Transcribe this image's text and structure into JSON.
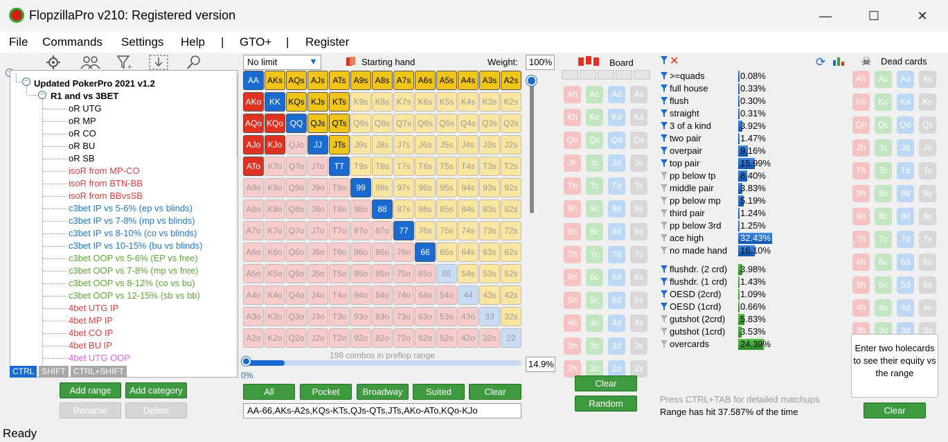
{
  "window": {
    "title": "FlopzillaPro v210: Registered version",
    "minimize": "—",
    "maximize": "☐",
    "close": "✕"
  },
  "menu": [
    "File",
    "Commands",
    "Settings",
    "Help",
    "|",
    "GTO+",
    "|",
    "Register"
  ],
  "toolbar_icons": [
    "settings-icon",
    "players-icon",
    "filter-icon",
    "import-icon",
    "search-icon"
  ],
  "tree": {
    "root": "Updated PokerPro 2021 v1.2",
    "group": "R1 and vs 3BET",
    "items": [
      {
        "label": "oR UTG",
        "color": "#000000"
      },
      {
        "label": "oR MP",
        "color": "#000000"
      },
      {
        "label": "oR CO",
        "color": "#000000"
      },
      {
        "label": "oR BU",
        "color": "#000000"
      },
      {
        "label": "oR SB",
        "color": "#000000"
      },
      {
        "label": "isoR from MP-CO",
        "color": "#e03c3c"
      },
      {
        "label": "isoR from BTN-BB",
        "color": "#e03c3c"
      },
      {
        "label": "isoR from BBvsSB",
        "color": "#e03c3c"
      },
      {
        "label": "c3bet IP vs 5-6% (ep vs blinds)",
        "color": "#1f77c8"
      },
      {
        "label": "c3bet IP vs 7-8% (mp vs blinds)",
        "color": "#1f77c8"
      },
      {
        "label": "c3bet IP vs 8-10% (co vs blinds)",
        "color": "#1f77c8"
      },
      {
        "label": "c3bet IP vs 10-15% (bu vs blinds)",
        "color": "#1f77c8"
      },
      {
        "label": "c3bet OOP vs 5-6% (EP vs free)",
        "color": "#5aa832"
      },
      {
        "label": "c3bet OOP vs 7-8% (mp vs free)",
        "color": "#5aa832"
      },
      {
        "label": "c3bet OOP vs 8-12% (co vs bu)",
        "color": "#5aa832"
      },
      {
        "label": "c3bet OOP vs 12-15% (sb vs bb)",
        "color": "#5aa832"
      },
      {
        "label": "4bet UTG IP",
        "color": "#e03c3c"
      },
      {
        "label": "4bet MP IP",
        "color": "#e03c3c"
      },
      {
        "label": "4bet CO IP",
        "color": "#e03c3c"
      },
      {
        "label": "4bet BU IP",
        "color": "#e03c3c"
      },
      {
        "label": "4bet UTG OOP",
        "color": "#e060e0"
      }
    ]
  },
  "modifiers": [
    "CTRL",
    "SHIFT",
    "CTRL+SHIFT"
  ],
  "range_buttons": {
    "add_range": "Add range",
    "add_category": "Add category",
    "rename": "Rename",
    "delete": "Delete"
  },
  "range": {
    "game_type": "No limit",
    "starting_hand_label": "Starting hand",
    "weight_label": "Weight:",
    "weight": "100%",
    "combos_text": "198 combos in preflop range",
    "percent": "14.9%",
    "progress_label": "0%",
    "progress": 0.149,
    "text": "AA-66,AKs-A2s,KQs-KTs,QJs-QTs,JTs,AKo-ATo,KQo-KJo"
  },
  "ranks": [
    "A",
    "K",
    "Q",
    "J",
    "T",
    "9",
    "8",
    "7",
    "6",
    "5",
    "4",
    "3",
    "2"
  ],
  "selected_hands": [
    "AA",
    "KK",
    "QQ",
    "JJ",
    "TT",
    "99",
    "88",
    "77",
    "66",
    "AKs",
    "AQs",
    "AJs",
    "ATs",
    "A9s",
    "A8s",
    "A7s",
    "A6s",
    "A5s",
    "A4s",
    "A3s",
    "A2s",
    "KQs",
    "KJs",
    "KTs",
    "QJs",
    "QTs",
    "JTs",
    "AKo",
    "AQo",
    "AJo",
    "ATo",
    "KQo",
    "KJo"
  ],
  "quick_buttons": [
    "All",
    "Pocket",
    "Broadway",
    "Suited",
    "Clear"
  ],
  "board": {
    "title": "Board",
    "clear": "Clear",
    "random": "Random",
    "suits": [
      "h",
      "c",
      "d",
      "s"
    ]
  },
  "dead": {
    "title": "Dead cards",
    "help": "Enter two holecards to see their equity vs the range",
    "clear": "Clear"
  },
  "colors": {
    "suit_h": "#f6c2c2",
    "suit_c": "#c2e6c0",
    "suit_d": "#bcd8f6",
    "suit_s": "#d8d8d8",
    "pair": "#c8dcf6",
    "suited": "#fbe6a0",
    "offsuit": "#f9cccc",
    "sel_pair": "#1a6bd1",
    "sel_suited": "#f0c419",
    "sel_offsuit": "#e03220"
  },
  "stats": [
    {
      "label": "&gt;=quads",
      "pct": "0.08%",
      "value": 0.08,
      "active": true,
      "type": "made"
    },
    {
      "label": "full house",
      "pct": "0.33%",
      "value": 0.33,
      "active": true,
      "type": "made"
    },
    {
      "label": "flush",
      "pct": "0.30%",
      "value": 0.3,
      "active": true,
      "type": "made"
    },
    {
      "label": "straight",
      "pct": "0.31%",
      "value": 0.31,
      "active": true,
      "type": "made"
    },
    {
      "label": "3 of a kind",
      "pct": "3.92%",
      "value": 3.92,
      "active": true,
      "type": "made"
    },
    {
      "label": "two pair",
      "pct": "1.47%",
      "value": 1.47,
      "active": true,
      "type": "made"
    },
    {
      "label": "overpair",
      "pct": "9.16%",
      "value": 9.16,
      "active": true,
      "type": "made"
    },
    {
      "label": "top pair",
      "pct": "15.99%",
      "value": 15.99,
      "active": true,
      "type": "made"
    },
    {
      "label": "pp below tp",
      "pct": "8.40%",
      "value": 8.4,
      "active": false,
      "type": "made"
    },
    {
      "label": "middle pair",
      "pct": "3.83%",
      "value": 3.83,
      "active": false,
      "type": "made"
    },
    {
      "label": "pp below mp",
      "pct": "5.19%",
      "value": 5.19,
      "active": false,
      "type": "made"
    },
    {
      "label": "third pair",
      "pct": "1.24%",
      "value": 1.24,
      "active": false,
      "type": "made"
    },
    {
      "label": "pp below 3rd",
      "pct": "1.25%",
      "value": 1.25,
      "active": false,
      "type": "made"
    },
    {
      "label": "ace high",
      "pct": "32.43%",
      "value": 32.43,
      "active": false,
      "type": "made"
    },
    {
      "label": "no made hand",
      "pct": "16.10%",
      "value": 16.1,
      "active": false,
      "type": "made"
    },
    {
      "label": "flushdr. (2 crd)",
      "pct": "3.98%",
      "value": 3.98,
      "active": true,
      "type": "draw"
    },
    {
      "label": "flushdr. (1 crd)",
      "pct": "1.43%",
      "value": 1.43,
      "active": true,
      "type": "draw"
    },
    {
      "label": "OESD (2crd)",
      "pct": "1.09%",
      "value": 1.09,
      "active": true,
      "type": "draw"
    },
    {
      "label": "OESD (1crd)",
      "pct": "0.66%",
      "value": 0.66,
      "active": true,
      "type": "draw"
    },
    {
      "label": "gutshot (2crd)",
      "pct": "5.83%",
      "value": 5.83,
      "active": false,
      "type": "draw"
    },
    {
      "label": "gutshot (1crd)",
      "pct": "3.53%",
      "value": 3.53,
      "active": false,
      "type": "draw"
    },
    {
      "label": "overcards",
      "pct": "24.39%",
      "value": 24.39,
      "active": false,
      "type": "draw"
    }
  ],
  "matchups_hint": "Press CTRL+TAB for detailed matchups",
  "hit_text": "Range has hit 37.587% of the time",
  "status": "Ready"
}
